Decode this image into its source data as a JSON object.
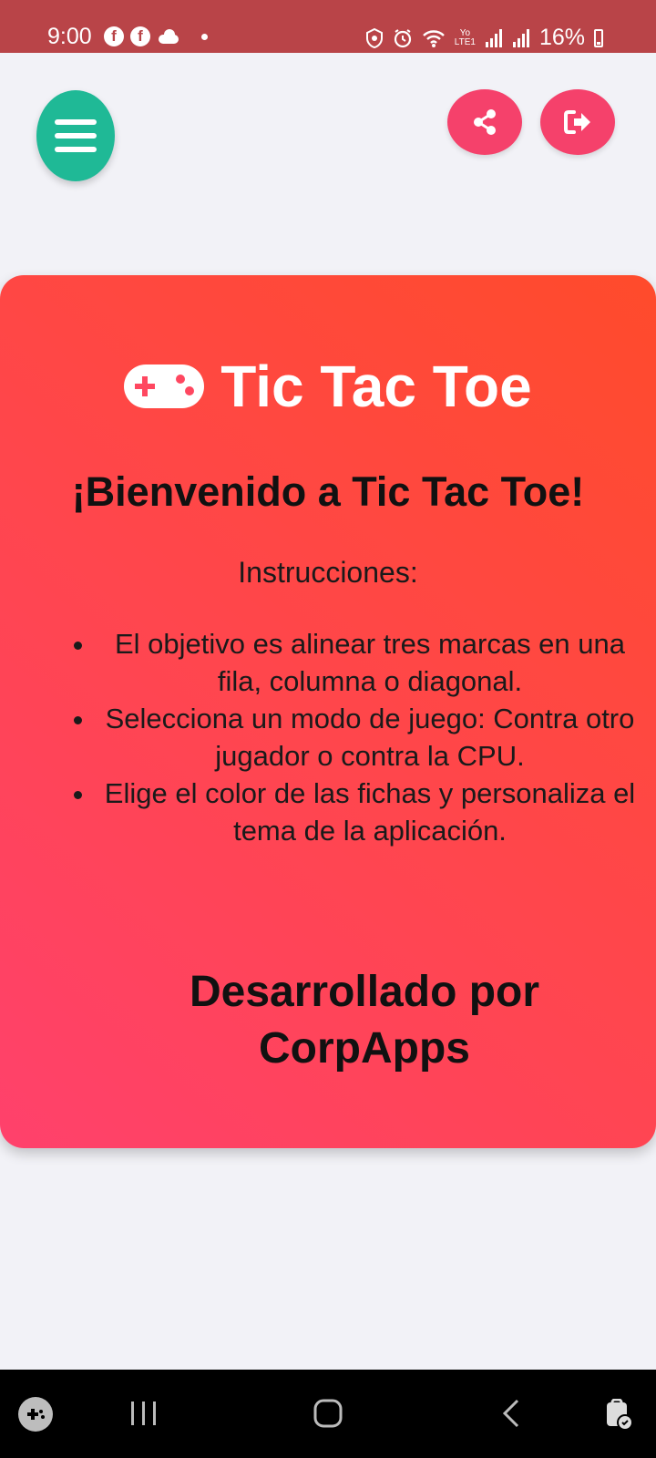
{
  "status_bar": {
    "time": "9:00",
    "battery": "16%",
    "network": "LTE1",
    "carrier": "Yo",
    "left_icons": [
      "facebook-icon",
      "facebook-icon",
      "cloud-icon",
      "dot-icon"
    ],
    "right_icons": [
      "vpn-icon",
      "alarm-icon",
      "wifi-icon",
      "signal-icon",
      "signal-icon",
      "battery-icon"
    ]
  },
  "header": {
    "menu_icon": "menu-icon",
    "share_icon": "share-icon",
    "logout_icon": "logout-icon"
  },
  "card": {
    "title_icon": "gamepad-icon",
    "title": "Tic Tac Toe",
    "welcome": "¡Bienvenido a Tic Tac Toe!",
    "instructions_label": "Instrucciones:",
    "instructions": [
      "El objetivo es alinear tres marcas en una fila, columna o diagonal.",
      "Selecciona un modo de juego: Contra otro jugador o contra la CPU.",
      "Elige el color de las fichas y personaliza el tema de la aplicación."
    ],
    "developer": "Desarrollado por CorpApps"
  },
  "nav_bar": {
    "icons": [
      "gamepad-icon",
      "recents-icon",
      "home-icon",
      "back-icon",
      "lock-icon"
    ]
  },
  "colors": {
    "status_bar": "#b94448",
    "menu_button": "#1fb996",
    "action_button": "#f5416b",
    "card_gradient_start": "#ff416c",
    "card_gradient_end": "#ff4b2b",
    "background": "#f2f2f7"
  }
}
